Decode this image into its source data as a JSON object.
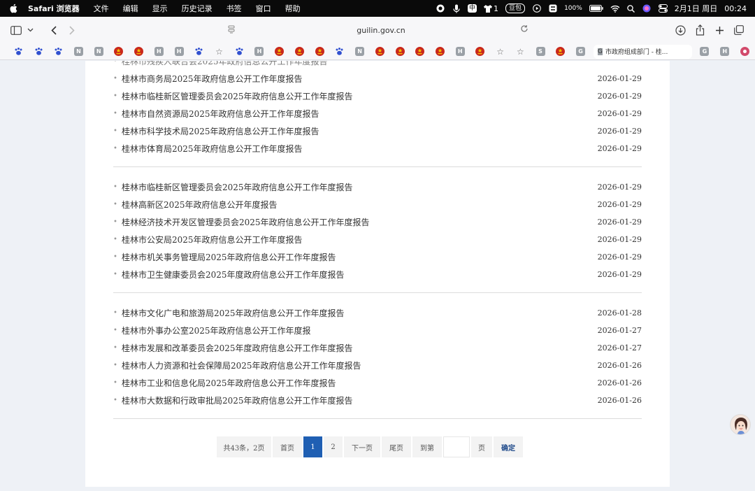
{
  "menubar": {
    "app_name": "Safari 浏览器",
    "menus": [
      "文件",
      "编辑",
      "显示",
      "历史记录",
      "书签",
      "窗口",
      "帮助"
    ],
    "status": {
      "ime": "中",
      "shirt_count": "1",
      "badge": "豆包",
      "battery": "100%",
      "date": "2月1日 周日",
      "time": "00:24"
    }
  },
  "toolbar": {
    "url": "guilin.gov.cn"
  },
  "bookmarks": {
    "icons": [
      {
        "kind": "paw",
        "text": ""
      },
      {
        "kind": "paw",
        "text": ""
      },
      {
        "kind": "paw",
        "text": ""
      },
      {
        "kind": "letter",
        "text": "N"
      },
      {
        "kind": "letter",
        "text": "N"
      },
      {
        "kind": "emblem",
        "text": ""
      },
      {
        "kind": "emblem",
        "text": ""
      },
      {
        "kind": "letter",
        "text": "H"
      },
      {
        "kind": "letter",
        "text": "H"
      },
      {
        "kind": "paw",
        "text": ""
      },
      {
        "kind": "star",
        "text": "☆"
      },
      {
        "kind": "paw",
        "text": ""
      },
      {
        "kind": "letter",
        "text": "H"
      },
      {
        "kind": "emblem",
        "text": ""
      },
      {
        "kind": "emblem",
        "text": ""
      },
      {
        "kind": "emblem",
        "text": ""
      },
      {
        "kind": "paw",
        "text": ""
      },
      {
        "kind": "letter",
        "text": "N"
      },
      {
        "kind": "emblem",
        "text": ""
      },
      {
        "kind": "emblem",
        "text": ""
      },
      {
        "kind": "emblem",
        "text": ""
      },
      {
        "kind": "emblem",
        "text": ""
      },
      {
        "kind": "letter",
        "text": "H"
      },
      {
        "kind": "emblem",
        "text": ""
      },
      {
        "kind": "star",
        "text": "☆"
      },
      {
        "kind": "star",
        "text": "☆"
      },
      {
        "kind": "letter",
        "text": "S"
      },
      {
        "kind": "emblem",
        "text": ""
      },
      {
        "kind": "letter",
        "text": "G"
      }
    ],
    "active_tab": {
      "icon": "G",
      "title": "市政府组成部门 - 桂..."
    },
    "trailing_icons": [
      {
        "kind": "letter",
        "text": "G"
      },
      {
        "kind": "letter",
        "text": "H"
      },
      {
        "kind": "pink",
        "text": ""
      }
    ]
  },
  "list_groups": [
    {
      "items": [
        {
          "title": "桂林市商务局2025年政府信息公开工作年度报告",
          "date": "2026-01-29"
        },
        {
          "title": "桂林市临桂新区管理委员会2025年政府信息公开工作年度报告",
          "date": "2026-01-29"
        },
        {
          "title": "桂林市自然资源局2025年政府信息公开工作年度报告",
          "date": "2026-01-29"
        },
        {
          "title": "桂林市科学技术局2025年政府信息公开工作年度报告",
          "date": "2026-01-29"
        },
        {
          "title": "桂林市体育局2025年政府信息公开工作年度报告",
          "date": "2026-01-29"
        }
      ]
    },
    {
      "items": [
        {
          "title": "桂林市临桂新区管理委员会2025年政府信息公开工作年度报告",
          "date": "2026-01-29"
        },
        {
          "title": "桂林高新区2025年政府信息公开年度报告",
          "date": "2026-01-29"
        },
        {
          "title": "桂林经济技术开发区管理委员会2025年政府信息公开工作年度报告",
          "date": "2026-01-29"
        },
        {
          "title": "桂林市公安局2025年政府信息公开工作年度报告",
          "date": "2026-01-29"
        },
        {
          "title": "桂林市机关事务管理局2025年政府信息公开工作年度报告",
          "date": "2026-01-29"
        },
        {
          "title": "桂林市卫生健康委员会2025年度政府信息公开工作年度报告",
          "date": "2026-01-29"
        }
      ]
    },
    {
      "items": [
        {
          "title": "桂林市文化广电和旅游局2025年政府信息公开工作年度报告",
          "date": "2026-01-28"
        },
        {
          "title": "桂林市外事办公室2025年政府信息公开工作年度报",
          "date": "2026-01-27"
        },
        {
          "title": "桂林市发展和改革委员会2025年度政府信息公开工作年度报告",
          "date": "2026-01-27"
        },
        {
          "title": "桂林市人力资源和社会保障局2025年政府信息公开工作年度报告",
          "date": "2026-01-26"
        },
        {
          "title": "桂林市工业和信息化局2025年政府信息公开工作年度报告",
          "date": "2026-01-26"
        },
        {
          "title": "桂林市大数据和行政审批局2025年政府信息公开工作年度报告",
          "date": "2026-01-26"
        }
      ]
    }
  ],
  "pagination": {
    "summary": "共43条，2页",
    "first": "首页",
    "pages": [
      "1",
      "2"
    ],
    "current_page": "1",
    "next": "下一页",
    "last": "尾页",
    "goto_label": "到第",
    "page_input_value": "",
    "page_suffix": "页",
    "confirm": "确定"
  },
  "colors": {
    "accent": "#1f5fb3",
    "page_bg": "#eef1f6"
  }
}
